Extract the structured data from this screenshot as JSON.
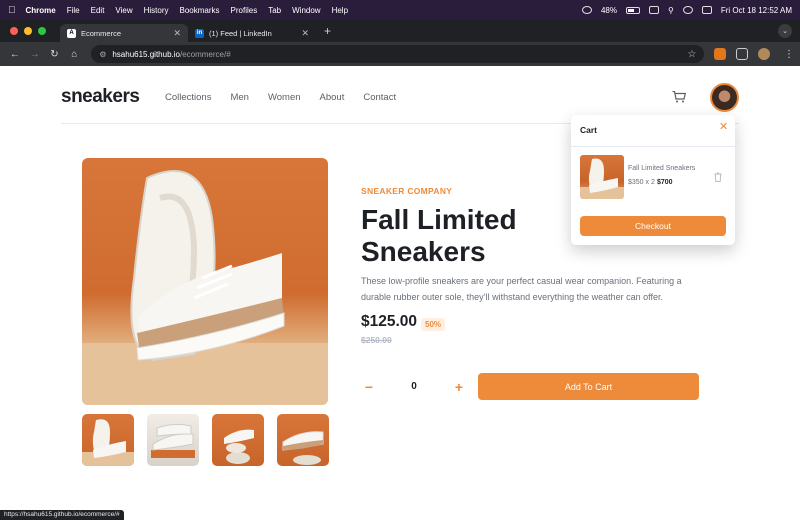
{
  "menubar": {
    "app": "Chrome",
    "items": [
      "File",
      "Edit",
      "View",
      "History",
      "Bookmarks",
      "Profiles",
      "Tab",
      "Window",
      "Help"
    ],
    "battery": "48%",
    "datetime": "Fri Oct 18  12:52 AM"
  },
  "browser": {
    "tabs": [
      {
        "title": "Ecommerce",
        "favicon": "A"
      },
      {
        "title": "(1) Feed | LinkedIn",
        "favicon": "in"
      }
    ],
    "url_host": "hsahu615.github.io",
    "url_path": "/ecommerce/#",
    "status_url": "https://hsahu615.github.io/ecommerce/#"
  },
  "site": {
    "logo": "sneakers",
    "nav": [
      "Collections",
      "Men",
      "Women",
      "About",
      "Contact"
    ]
  },
  "product": {
    "company": "SNEAKER COMPANY",
    "title": "Fall Limited Sneakers",
    "description": "These low-profile sneakers are your perfect casual wear companion. Featuring a durable rubber outer sole, they’ll withstand everything the weather can offer.",
    "price": "$125.00",
    "discount": "50%",
    "old_price": "$250.00",
    "quantity": "0",
    "add_to_cart": "Add To Cart"
  },
  "cart": {
    "title": "Cart",
    "item_name": "Fall Limited Sneakers",
    "item_price": "$350 x 2",
    "item_total": "$700",
    "checkout": "Checkout"
  },
  "colors": {
    "accent": "#ee8b3a",
    "dark": "#1d2025"
  }
}
